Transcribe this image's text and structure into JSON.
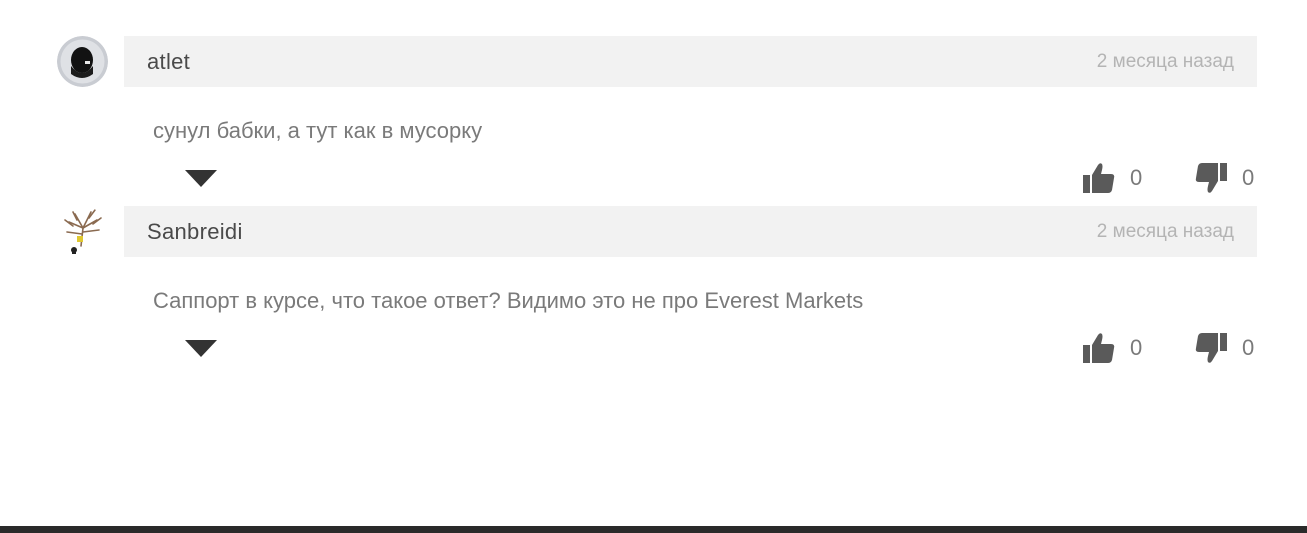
{
  "comments": [
    {
      "author": "atlet",
      "time": "2 месяца назад",
      "text": "сунул бабки, а тут как в мусорку",
      "likes": "0",
      "dislikes": "0"
    },
    {
      "author": "Sanbreidi",
      "time": "2 месяца назад",
      "text": "Саппорт в курсе, что такое ответ? Видимо это не про Everest Markets",
      "likes": "0",
      "dislikes": "0"
    }
  ],
  "icons": {
    "like": "thumbs-up-icon",
    "dislike": "thumbs-down-icon",
    "expand": "caret-down-icon"
  },
  "colors": {
    "header_bg": "#f2f2f2",
    "author": "#4a4a4a",
    "timestamp": "#b4b4b4",
    "text": "#7a7a7a",
    "icon": "#5a5a5a",
    "footer": "#2a2a2a"
  }
}
